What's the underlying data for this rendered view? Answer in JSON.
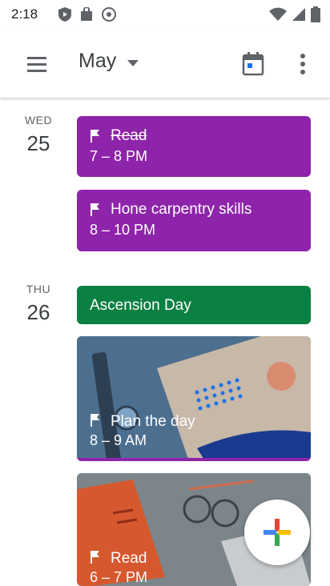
{
  "status": {
    "time": "2:18"
  },
  "header": {
    "month": "May"
  },
  "days": [
    {
      "dow": "WED",
      "num": "25"
    },
    {
      "dow": "THU",
      "num": "26"
    }
  ],
  "events": {
    "read1": {
      "title": "Read",
      "time": "7 – 8 PM"
    },
    "carpentry": {
      "title": "Hone carpentry skills",
      "time": "8 – 10 PM"
    },
    "ascension": {
      "title": "Ascension Day"
    },
    "plan": {
      "title": "Plan the day",
      "time": "8 – 9 AM"
    },
    "read2": {
      "title": "Read",
      "time": "6 – 7 PM"
    }
  },
  "colors": {
    "purple": "#8e24aa",
    "green": "#0b8043",
    "accent_blue": "#1a73e8"
  }
}
